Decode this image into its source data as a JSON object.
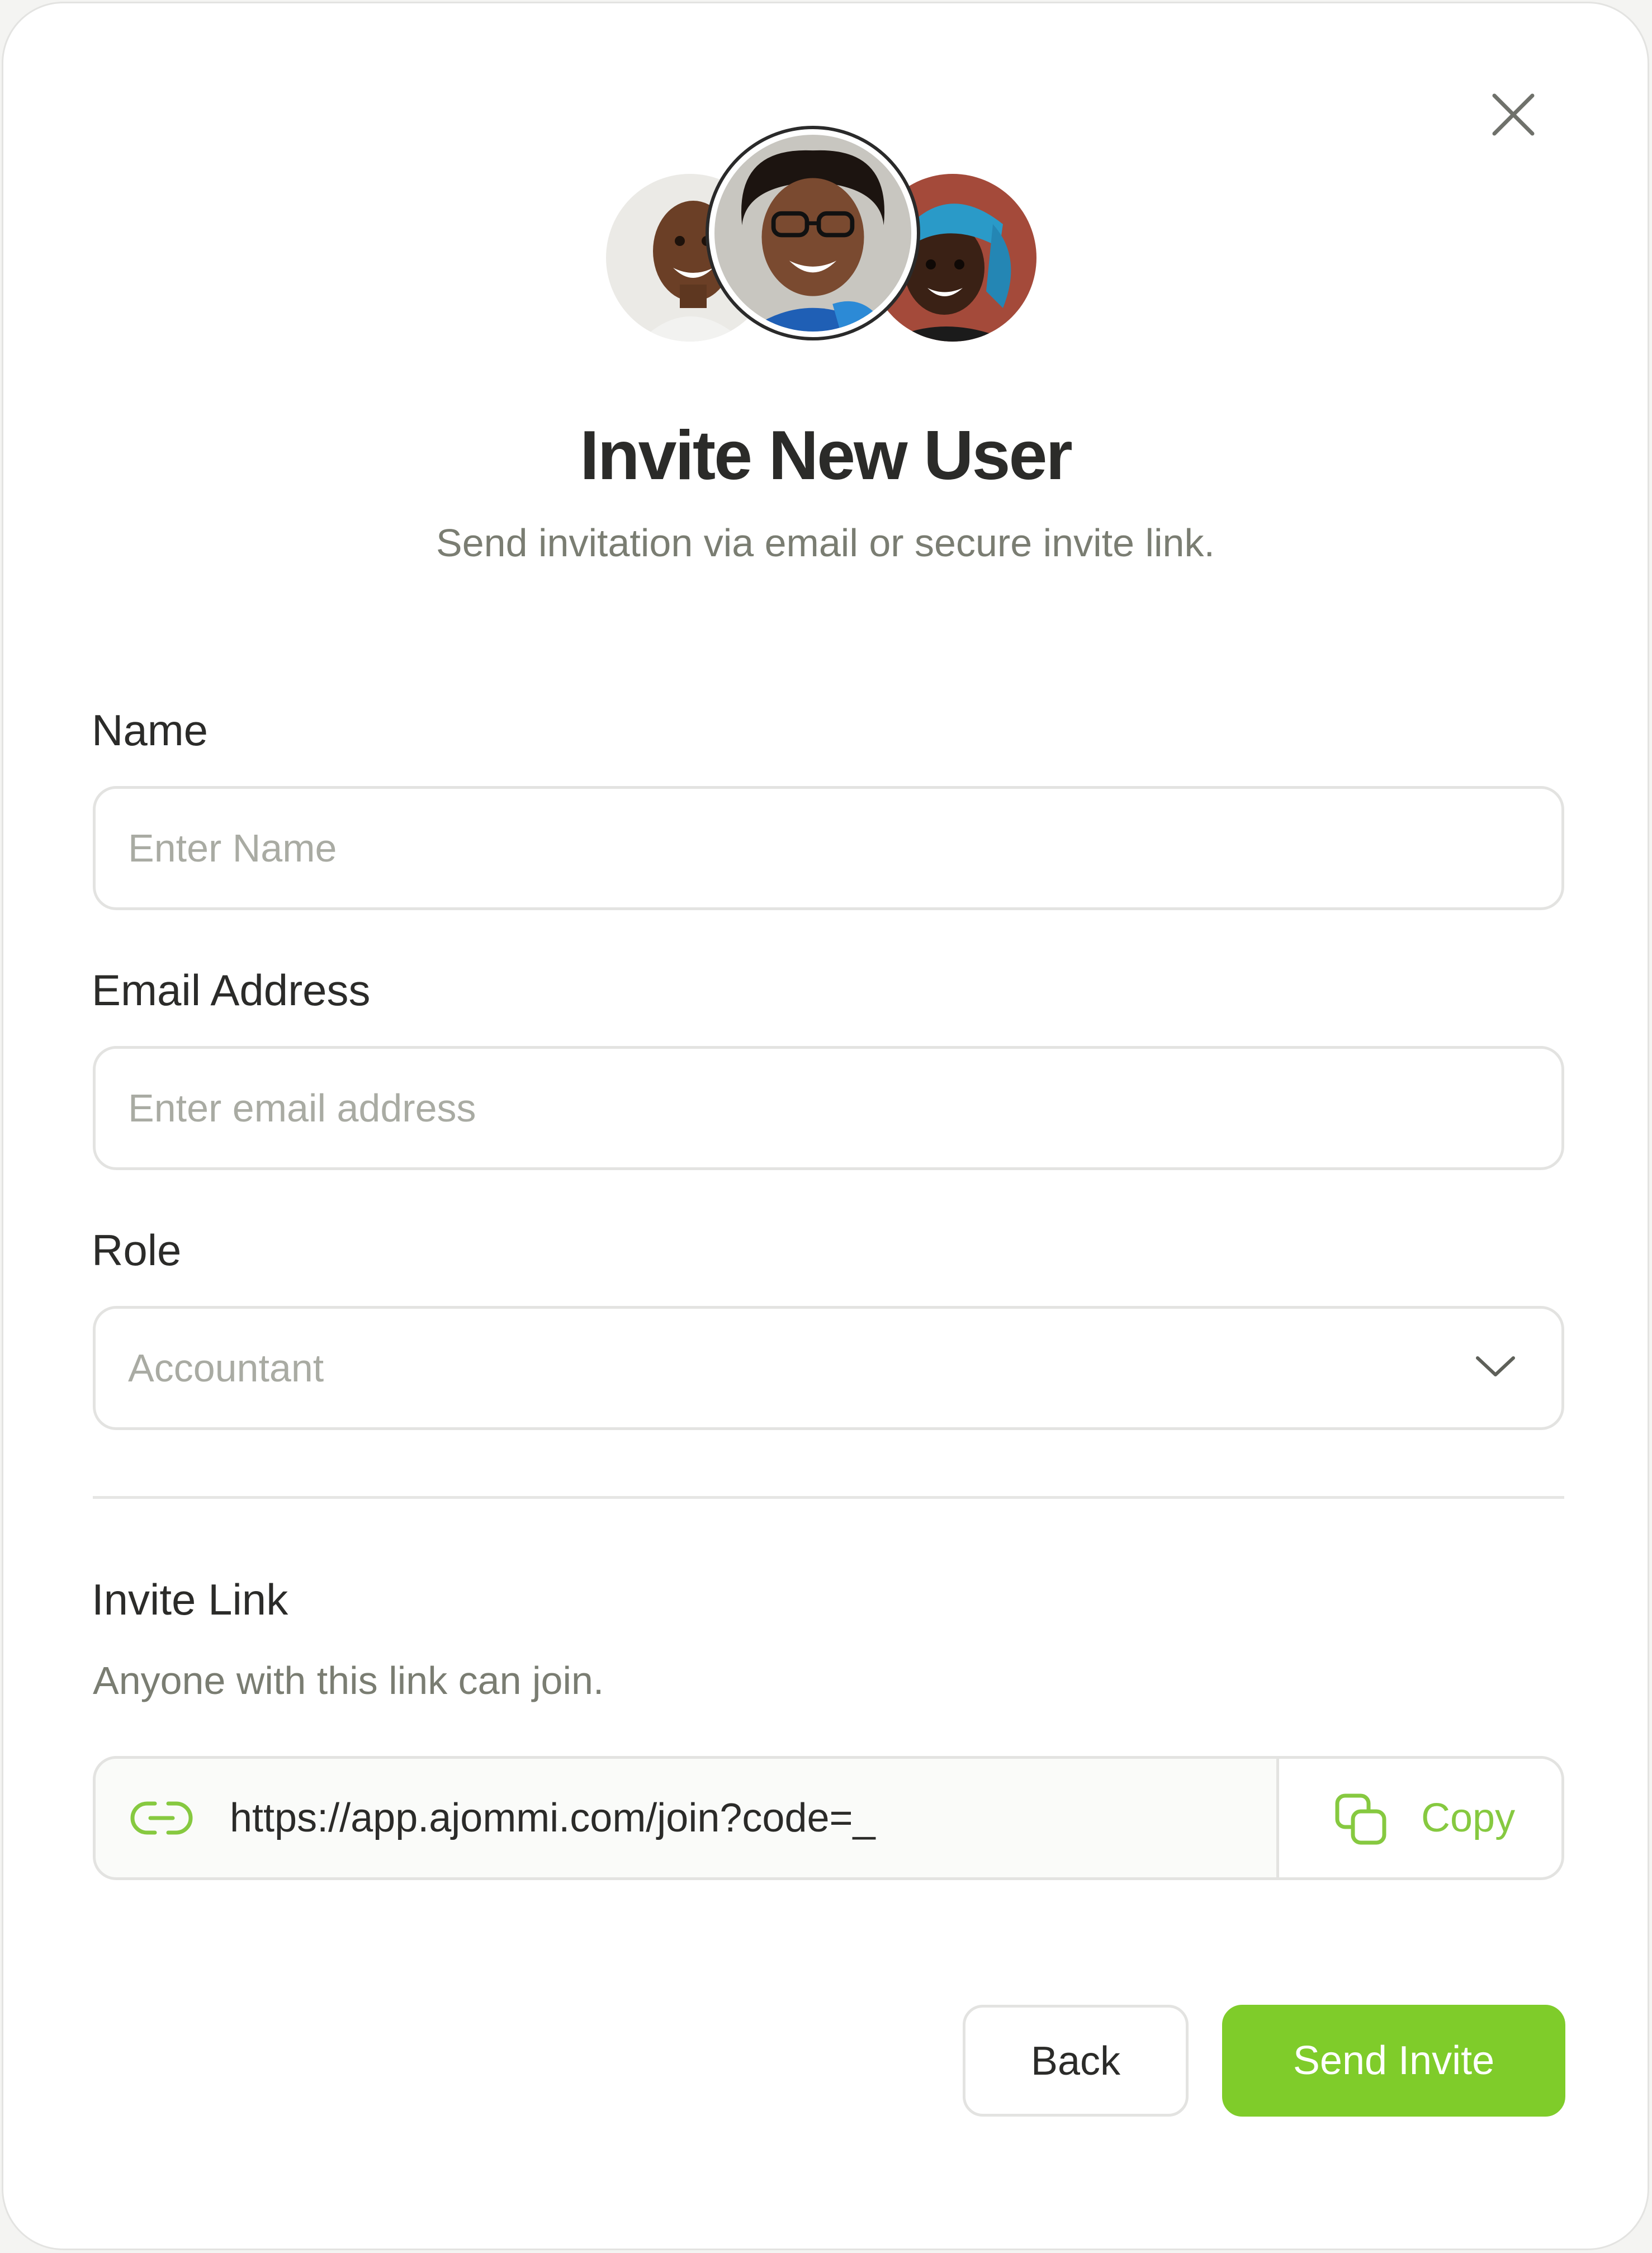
{
  "dialog": {
    "title": "Invite New User",
    "subtitle": "Send invitation via email or secure invite link.",
    "close_icon": "close-icon"
  },
  "avatars": [
    {
      "name": "avatar-user-1"
    },
    {
      "name": "avatar-user-2"
    },
    {
      "name": "avatar-user-3"
    }
  ],
  "form": {
    "name": {
      "label": "Name",
      "placeholder": "Enter Name",
      "value": ""
    },
    "email": {
      "label": "Email Address",
      "placeholder": "Enter email address",
      "value": ""
    },
    "role": {
      "label": "Role",
      "value": "Accountant",
      "icon": "chevron-down-icon"
    }
  },
  "invite_link": {
    "label": "Invite Link",
    "hint": "Anyone with this link can join.",
    "url": "https://app.ajommi.com/join?code=_",
    "link_icon": "link-icon",
    "copy_icon": "copy-icon",
    "copy_label": "Copy"
  },
  "actions": {
    "back_label": "Back",
    "send_label": "Send Invite"
  },
  "colors": {
    "accent": "#7fcc2a",
    "text": "#2b2b29",
    "muted": "#7a7d72",
    "border": "#e3e3e1"
  }
}
